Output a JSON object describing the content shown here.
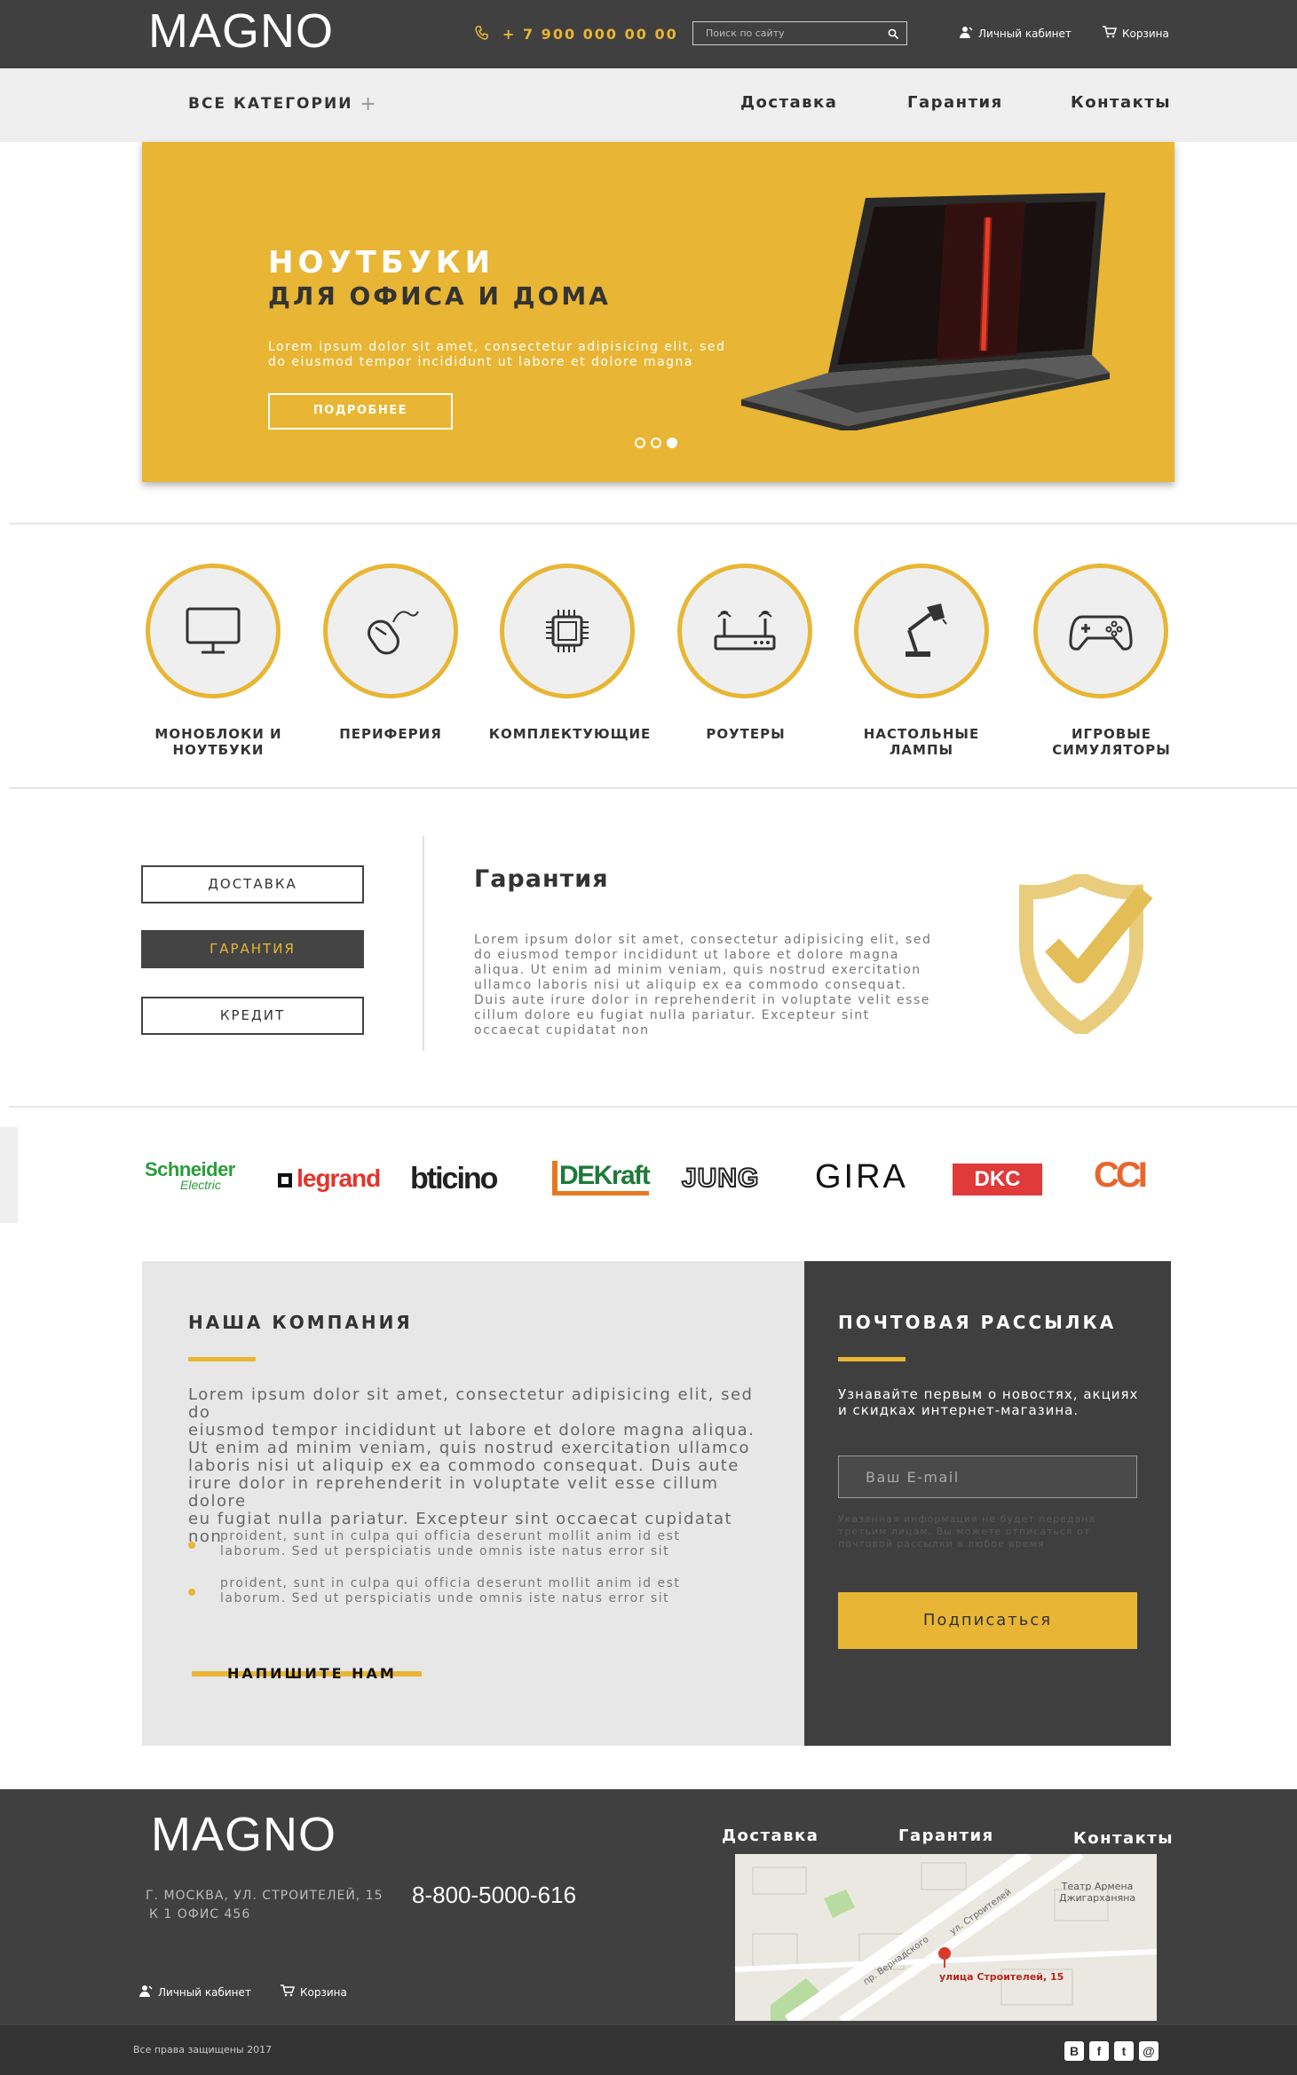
{
  "header": {
    "logo": "MAGNO",
    "phone": "+ 7 900 000 00 00",
    "search_placeholder": "Поиск по сайту",
    "account": "Личный кабинет",
    "cart": "Корзина"
  },
  "nav": {
    "all_categories": "ВСЕ КАТЕГОРИИ",
    "items": [
      "Доставка",
      "Гарантия",
      "Контакты"
    ]
  },
  "banner": {
    "title": "НОУТБУКИ",
    "subtitle": "ДЛЯ ОФИСА И ДОМА",
    "text_line1": "Lorem ipsum dolor sit amet, consectetur adipisicing elit, sed",
    "text_line2": "do eiusmod tempor incididunt ut labore et dolore magna",
    "button": "ПОДРОБНЕЕ",
    "slides_total": 3,
    "active_slide": 3
  },
  "categories": [
    {
      "label_line1": "МОНОБЛОКИ И",
      "label_line2": "НОУТБУКИ",
      "icon": "monitor-icon"
    },
    {
      "label_line1": "ПЕРИФЕРИЯ",
      "label_line2": "",
      "icon": "mouse-icon"
    },
    {
      "label_line1": "КОМПЛЕКТУЮЩИЕ",
      "label_line2": "",
      "icon": "chip-icon"
    },
    {
      "label_line1": "РОУТЕРЫ",
      "label_line2": "",
      "icon": "router-icon"
    },
    {
      "label_line1": "НАСТОЛЬНЫЕ",
      "label_line2": "ЛАМПЫ",
      "icon": "lamp-icon"
    },
    {
      "label_line1": "ИГРОВЫЕ",
      "label_line2": "СИМУЛЯТОРЫ",
      "icon": "gamepad-icon"
    }
  ],
  "info": {
    "tabs": [
      "ДОСТАВКА",
      "ГАРАНТИЯ",
      "КРЕДИТ"
    ],
    "active_tab": "ГАРАНТИЯ",
    "title": "Гарантия",
    "lines": [
      "Lorem ipsum dolor sit amet, consectetur adipisicing elit, sed",
      "do eiusmod tempor incididunt ut labore et dolore magna",
      "aliqua. Ut enim ad minim veniam, quis nostrud exercitation",
      "ullamco laboris nisi ut aliquip ex ea commodo consequat.",
      "Duis aute irure dolor in reprehenderit in voluptate velit esse",
      "cillum dolore eu fugiat nulla pariatur. Excepteur sint",
      "occaecat cupidatat non"
    ]
  },
  "brands": [
    "Schneider",
    "Electric",
    "legrand",
    "bticino",
    "DEKraft",
    "JUNG",
    "GIRA",
    "DKC",
    "CCI"
  ],
  "company": {
    "title": "НАША КОМПАНИЯ",
    "lines": [
      "Lorem ipsum dolor sit amet, consectetur adipisicing elit, sed do",
      "eiusmod tempor incididunt ut labore et dolore magna aliqua.",
      "Ut enim ad minim veniam, quis nostrud exercitation ullamco",
      "laboris nisi ut aliquip ex ea commodo consequat. Duis aute",
      "irure dolor in reprehenderit in voluptate velit esse cillum dolore",
      "eu fugiat nulla pariatur. Excepteur sint occaecat cupidatat non"
    ],
    "bullets": [
      {
        "line1": "proident, sunt in culpa qui officia deserunt mollit anim id est",
        "line2": "laborum. Sed ut perspiciatis unde omnis iste natus error sit"
      },
      {
        "line1": "proident, sunt in culpa qui officia deserunt mollit anim id est",
        "line2": "laborum. Sed ut perspiciatis unde omnis iste natus error sit"
      }
    ],
    "write_us": "НАПИШИТЕ НАМ"
  },
  "newsletter": {
    "title": "ПОЧТОВАЯ РАССЫЛКА",
    "text_line1": "Узнавайте первым о новостях, акциях",
    "text_line2": "и скидках интернет-магазина.",
    "email_placeholder": "Ваш E-mail",
    "note_line1": "Указанная информация не будет передана",
    "note_line2": "третьим лицам. Вы можете отписаться от",
    "note_line3": "почтовой рассылки в любое время",
    "button": "Подписаться"
  },
  "footer": {
    "logo": "MAGNO",
    "address_line1": "Г. МОСКВА, УЛ. СТРОИТЕЛЕЙ, 15",
    "address_line2": "К 1 ОФИС 456",
    "phone": "8-800-5000-616",
    "links": [
      "Доставка",
      "Гарантия",
      "Контакты"
    ],
    "account": "Личный кабинет",
    "cart": "Корзина",
    "map_street_label": "улица Строителей, 15",
    "map_theatre_line1": "Театр Армена",
    "map_theatre_line2": "Джигарханяна",
    "map_road1": "пр. Вернадского",
    "map_road2": "ул. Строителей",
    "copyright": "Все права защищены 2017",
    "social": [
      "В",
      "f",
      "t",
      "@"
    ]
  },
  "colors": {
    "accent": "#e8b634",
    "dark": "#404040",
    "light": "#efefef"
  }
}
